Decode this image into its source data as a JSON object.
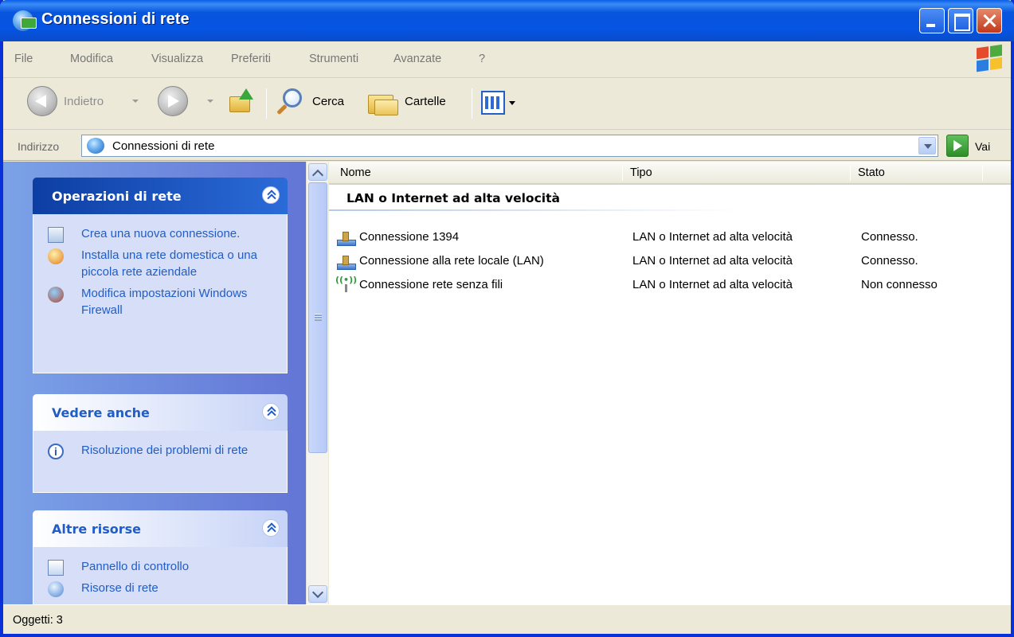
{
  "window": {
    "title": "Connessioni di rete"
  },
  "menu": {
    "items": [
      "File",
      "Modifica",
      "Visualizza",
      "Preferiti",
      "Strumenti",
      "Avanzate",
      "?"
    ]
  },
  "toolbar": {
    "back_label": "Indietro",
    "search_label": "Cerca",
    "folders_label": "Cartelle"
  },
  "address": {
    "label": "Indirizzo",
    "value": "Connessioni di rete",
    "go_label": "Vai"
  },
  "taskpane": {
    "network_tasks": {
      "title": "Operazioni di rete",
      "items": [
        {
          "label": "Crea una nuova connessione.",
          "icon": "new-connection-icon"
        },
        {
          "label": "Installa una rete domestica o una piccola rete aziendale",
          "icon": "home-network-icon"
        },
        {
          "label": "Modifica impostazioni Windows Firewall",
          "icon": "firewall-icon"
        }
      ]
    },
    "see_also": {
      "title": "Vedere anche",
      "items": [
        {
          "label": "Risoluzione dei problemi di rete",
          "icon": "info-icon"
        }
      ]
    },
    "other_places": {
      "title": "Altre risorse",
      "items": [
        {
          "label": "Pannello di controllo",
          "icon": "control-panel-icon"
        },
        {
          "label": "Risorse di rete",
          "icon": "network-places-icon"
        }
      ]
    }
  },
  "filelist": {
    "columns": [
      "Nome",
      "Tipo",
      "Stato"
    ],
    "group_title": "LAN o Internet ad alta velocità",
    "rows": [
      {
        "name": "Connessione 1394",
        "type": "LAN o Internet ad alta velocità",
        "status": "Connesso.",
        "icon": "lan-icon"
      },
      {
        "name": "Connessione alla rete locale (LAN)",
        "type": "LAN o Internet ad alta velocità",
        "status": "Connesso.",
        "icon": "lan-icon"
      },
      {
        "name": "Connessione rete senza fili",
        "type": "LAN o Internet ad alta velocità",
        "status": "Non connesso",
        "icon": "wireless-icon"
      }
    ]
  },
  "statusbar": {
    "text": "Oggetti: 3"
  }
}
